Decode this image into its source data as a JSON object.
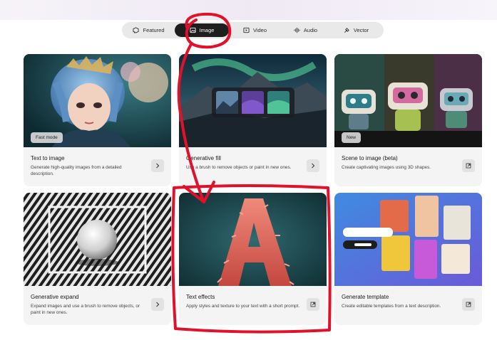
{
  "tabs": [
    {
      "label": "Featured",
      "icon": "featured-icon",
      "active": false
    },
    {
      "label": "Image",
      "icon": "image-icon",
      "active": true
    },
    {
      "label": "Video",
      "icon": "video-icon",
      "active": false
    },
    {
      "label": "Audio",
      "icon": "audio-icon",
      "active": false
    },
    {
      "label": "Vector",
      "icon": "vector-icon",
      "active": false
    }
  ],
  "cards": [
    {
      "title": "Text to image",
      "desc": "Generate high-quality images from a detailed description.",
      "badge": "Fast mode",
      "action_icon": "arrow-right-icon"
    },
    {
      "title": "Generative fill",
      "desc": "Use a brush to remove objects or paint in new ones.",
      "action_icon": "arrow-right-icon"
    },
    {
      "title": "Scene to image (beta)",
      "desc": "Create captivating images using 3D shapes.",
      "badge": "New",
      "action_icon": "external-link-icon"
    },
    {
      "title": "Generative expand",
      "desc": "Expand images and use a brush to remove objects, or paint in new ones.",
      "action_icon": "arrow-right-icon"
    },
    {
      "title": "Text effects",
      "desc": "Apply styles and texture to your text with a short prompt.",
      "action_icon": "external-link-icon"
    },
    {
      "title": "Generate template",
      "desc": "Create editable templates from a text description.",
      "action_icon": "external-link-icon"
    }
  ],
  "colors": {
    "annotation": "#e0122b",
    "active_tab": "#1e1e1e",
    "card_bg": "#f4f4f4"
  }
}
